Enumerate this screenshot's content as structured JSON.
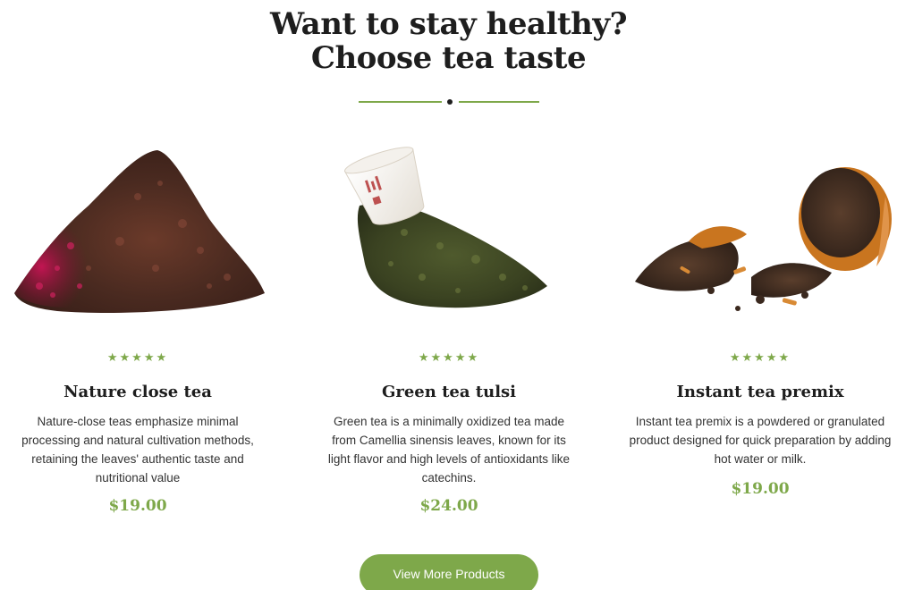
{
  "heading": {
    "line1": "Want to stay healthy?",
    "line2": "Choose tea taste"
  },
  "colors": {
    "accent": "#7ea84a",
    "heading": "#1e1e1e",
    "text": "#333333"
  },
  "products": [
    {
      "image": "red-loose-leaf-tea-image",
      "rating": 5,
      "stars": "★★★★★",
      "title": "Nature close tea",
      "description": "Nature-close teas emphasize minimal processing and natural cultivation methods, retaining the leaves' authentic taste and nutritional value",
      "price": "$19.00"
    },
    {
      "image": "green-tea-with-cup-image",
      "rating": 5,
      "stars": "★★★★★",
      "title": "Green tea tulsi",
      "description": "Green tea is a minimally oxidized tea made from Camellia sinensis leaves, known for its light flavor and high levels of antioxidants like catechins.",
      "price": "$24.00"
    },
    {
      "image": "dark-tea-in-orange-peel-image",
      "rating": 5,
      "stars": "★★★★★",
      "title": "Instant tea premix",
      "description": "Instant tea premix is a powdered or granulated product designed for quick preparation by adding hot water or milk.",
      "price": "$19.00"
    }
  ],
  "cta": {
    "label": "View More Products"
  }
}
